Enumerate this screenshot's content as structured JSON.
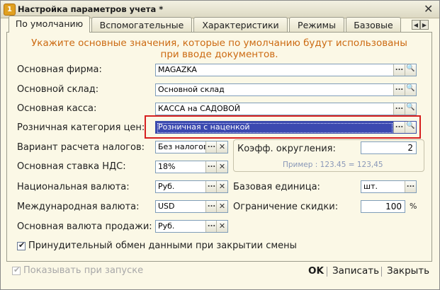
{
  "window": {
    "title": "Настройка параметров учета *"
  },
  "tabs": [
    "По умолчанию",
    "Вспомогательные",
    "Характеристики",
    "Режимы",
    "Базовые"
  ],
  "hint": {
    "line1": "Укажите основные значения, которые по умолчанию будут использованы",
    "line2": "при вводе документов."
  },
  "fields": {
    "firm": {
      "label": "Основная фирма:",
      "value": "MAGAZKA"
    },
    "warehouse": {
      "label": "Основной склад:",
      "value": "Основной склад"
    },
    "cash": {
      "label": "Основная касса:",
      "value": "КАССА на САДОВОЙ"
    },
    "price_category": {
      "label": "Розничная категория цен:",
      "value": "Розничная с наценкой"
    },
    "tax_variant": {
      "label": "Вариант расчета налогов:",
      "value": "Без налогов"
    },
    "vat_rate": {
      "label": "Основная ставка НДС:",
      "value": "18%"
    },
    "national_currency": {
      "label": "Национальная валюта:",
      "value": "Руб."
    },
    "international_currency": {
      "label": "Международная валюта:",
      "value": "USD"
    },
    "sales_currency": {
      "label": "Основная валюта продажи:",
      "value": "Руб."
    }
  },
  "rounding": {
    "label": "Коэфф. округления:",
    "value": "2",
    "example": "Пример : 123.45 = 123,45"
  },
  "base_unit": {
    "label": "Базовая единица:",
    "value": "шт."
  },
  "discount_limit": {
    "label": "Ограничение скидки:",
    "value": "100",
    "unit": "%"
  },
  "forced_exchange": {
    "label": "Принудительный обмен данными  при закрытии смены",
    "checked": true
  },
  "show_on_start": {
    "label": "Показывать при запуске",
    "checked": true,
    "disabled": true
  },
  "buttons": {
    "ok": "OK",
    "save": "Записать",
    "close": "Закрыть"
  },
  "glyphs": {
    "dots": "...",
    "search": "🔍",
    "clear": "✕",
    "check": "✔",
    "tab_left": "◀",
    "tab_right": "▶",
    "window_close": "✕",
    "app": "1"
  },
  "colors": {
    "hint": "#cc6a12",
    "selection": "#3b49b0",
    "highlight_box": "#d62020"
  }
}
